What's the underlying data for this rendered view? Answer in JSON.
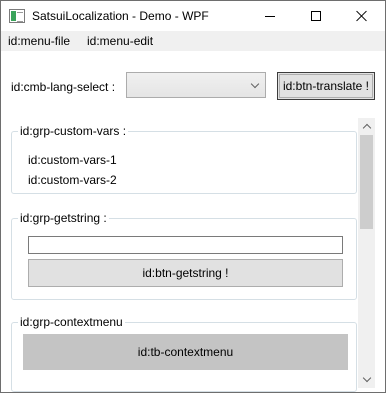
{
  "window": {
    "title": "SatsuiLocalization - Demo - WPF"
  },
  "menu": {
    "items": [
      {
        "label": "id:menu-file"
      },
      {
        "label": "id:menu-edit"
      }
    ]
  },
  "toolbar": {
    "lang_label": "id:cmb-lang-select :",
    "combo_value": "",
    "translate_button": "id:btn-translate !"
  },
  "groups": {
    "custom_vars": {
      "header": "id:grp-custom-vars :",
      "lines": [
        "id:custom-vars-1",
        "id:custom-vars-2"
      ]
    },
    "getstring": {
      "header": "id:grp-getstring :",
      "input_value": "",
      "button_label": "id:btn-getstring !"
    },
    "contextmenu": {
      "header": "id:grp-contextmenu",
      "block_label": "id:tb-contextmenu"
    }
  },
  "icons": {
    "app": "app-window-icon",
    "minimize": "minimize-icon",
    "maximize": "maximize-icon",
    "close": "close-icon",
    "dropdown": "chevron-down-icon",
    "scroll_up": "chevron-up-icon",
    "scroll_down": "chevron-down-icon"
  },
  "colors": {
    "menubar_bg": "#f0f0f0",
    "button_bg": "#e1e1e1",
    "context_block_bg": "#c4c4c4",
    "group_border": "#d5dfe5"
  }
}
